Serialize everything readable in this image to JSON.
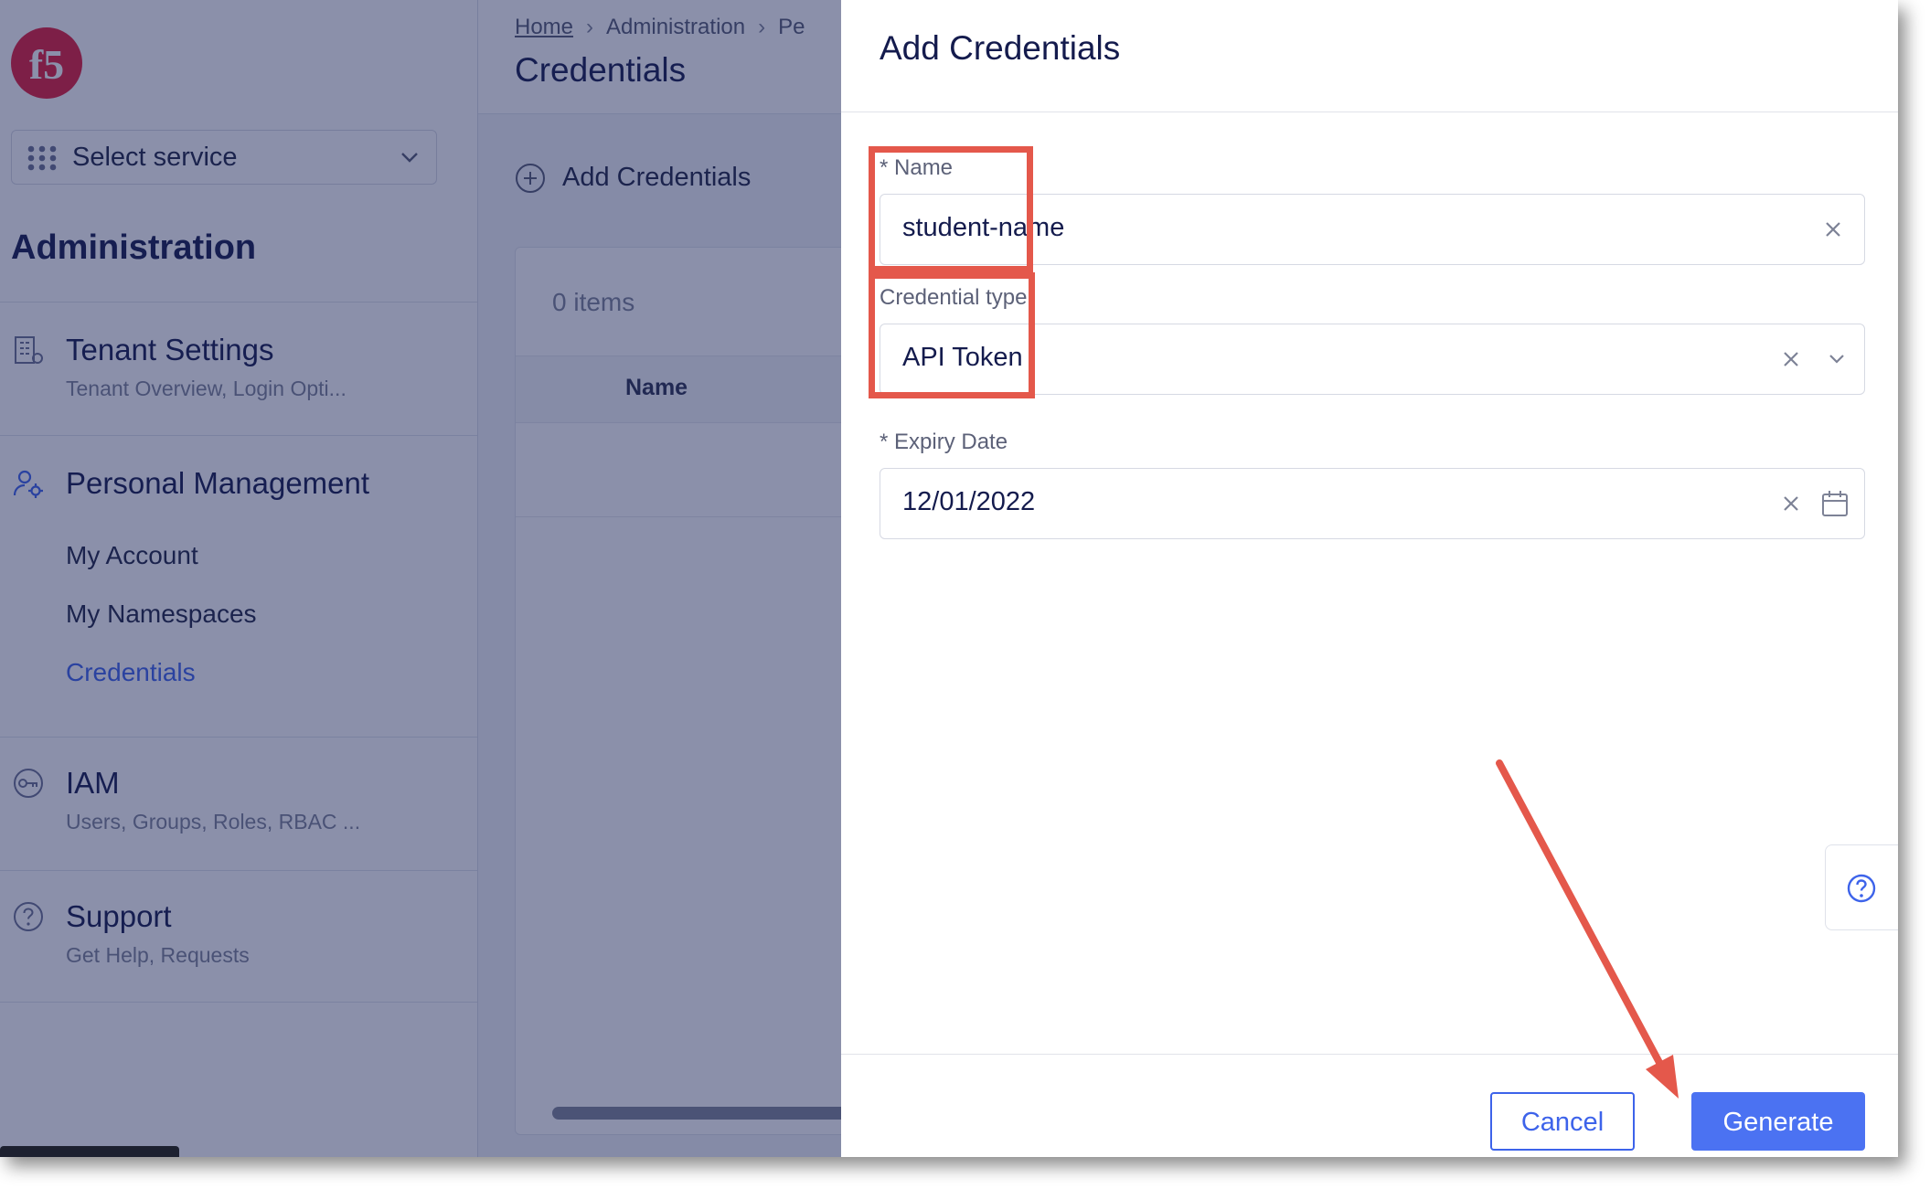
{
  "sidebar": {
    "service_select_label": "Select service",
    "section_title": "Administration",
    "nav": {
      "tenant_settings": {
        "title": "Tenant Settings",
        "subtitle": "Tenant Overview, Login Opti..."
      },
      "personal_management": {
        "title": "Personal Management",
        "links": [
          "My Account",
          "My Namespaces",
          "Credentials"
        ],
        "active": "Credentials"
      },
      "iam": {
        "title": "IAM",
        "subtitle": "Users, Groups, Roles, RBAC ..."
      },
      "support": {
        "title": "Support",
        "subtitle": "Get Help, Requests"
      }
    }
  },
  "header": {
    "breadcrumbs": [
      "Home",
      "Administration",
      "Pe"
    ],
    "title": "Credentials"
  },
  "main": {
    "add_button_label": "Add Credentials",
    "items_count": "0 items",
    "table_columns": [
      "Name"
    ]
  },
  "drawer": {
    "title": "Add Credentials",
    "fields": {
      "name": {
        "label": "* Name",
        "value": "student-name"
      },
      "credential_type": {
        "label": "Credential type",
        "value": "API Token"
      },
      "expiry_date": {
        "label": "* Expiry Date",
        "value": "12/01/2022"
      }
    },
    "buttons": {
      "cancel": "Cancel",
      "generate": "Generate"
    }
  },
  "colors": {
    "accent": "#4b72f2",
    "annotation": "#e4584b",
    "brand_logo": "#e21d38",
    "title_text": "#141b4d"
  },
  "icons": [
    "f5-logo",
    "grid-icon",
    "chevron-down-icon",
    "building-icon",
    "user-gear-icon",
    "key-icon",
    "help-circle-icon",
    "plus-circle-icon",
    "close-icon",
    "calendar-icon",
    "question-icon"
  ]
}
